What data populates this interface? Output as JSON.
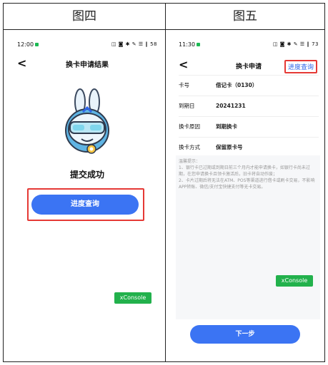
{
  "captions": {
    "left": "图四",
    "right": "图五"
  },
  "left": {
    "status": {
      "time": "12:00",
      "right": "◫ ◙ ✱ ✎ ☰ ‖ 58"
    },
    "title": "换卡申请结果",
    "success_text": "提交成功",
    "button_label": "进度查询",
    "xconsole": "xConsole"
  },
  "right": {
    "status": {
      "time": "11:30",
      "right": "◫ ◙ ✱ ✎ ☰ ‖ 73"
    },
    "title": "换卡申请",
    "progress_link": "进度查询",
    "rows": [
      {
        "k": "卡号",
        "v": "借记卡（0130）"
      },
      {
        "k": "到期日",
        "v": "20241231"
      },
      {
        "k": "换卡原因",
        "v": "到期换卡"
      },
      {
        "k": "换卡方式",
        "v": "保留原卡号"
      }
    ],
    "tips": "温馨提示：\n1、银行卡已过期或到期日前三个月内才能申请换卡，如银行卡尚未过期，在您申请换卡且领卡激活后，旧卡将自动作废；\n2、卡片过期后将无法在ATM、POS等渠道进行借卡或刷卡交易，不影响APP转账、微信/支付宝快捷支付等无卡交易。",
    "next_button": "下一步",
    "xconsole": "xConsole"
  }
}
